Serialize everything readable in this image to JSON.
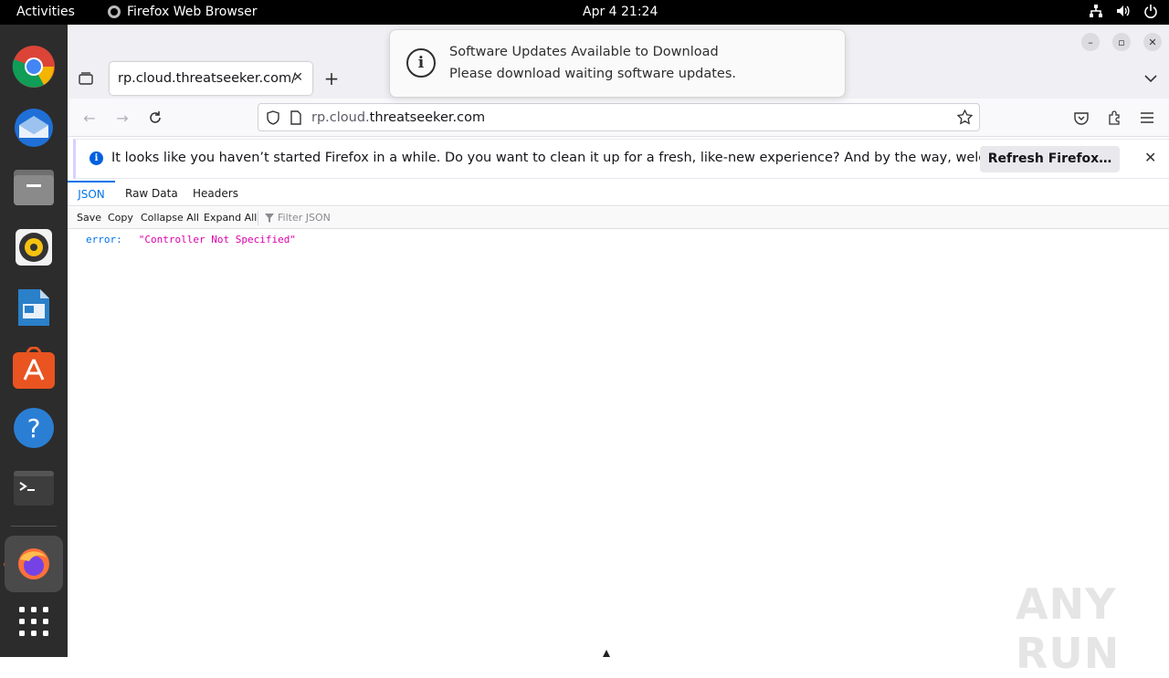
{
  "topbar": {
    "activities": "Activities",
    "app_name": "Firefox Web Browser",
    "clock": "Apr 4  21:24"
  },
  "dock": {
    "items": [
      "chrome-icon",
      "thunderbird-icon",
      "files-icon",
      "rhythmbox-icon",
      "writer-icon",
      "app-center-icon",
      "help-icon",
      "terminal-icon",
      "firefox-icon",
      "app-grid-icon"
    ]
  },
  "browser": {
    "tab_title": "rp.cloud.threatseeker.com/",
    "url_prefix": "rp.cloud.",
    "url_host": "threatseeker.com",
    "infobar_message": "It looks like you haven’t started Firefox in a while. Do you want to clean it up for a fresh, like-new experience? And by the way, welcome back!",
    "infobar_button": "Refresh Firefox…"
  },
  "json_viewer": {
    "tabs": [
      "JSON",
      "Raw Data",
      "Headers"
    ],
    "toolbar": [
      "Save",
      "Copy",
      "Collapse All",
      "Expand All"
    ],
    "filter_placeholder": "Filter JSON",
    "key": "error:",
    "value": "\"Controller Not Specified\""
  },
  "notification": {
    "title": "Software Updates Available to Download",
    "body": "Please download waiting software updates."
  },
  "watermark": "ANY RUN",
  "colors": {
    "accent": "#0074e8",
    "json_string": "#dd00a9",
    "ubuntu_orange": "#e95420"
  }
}
